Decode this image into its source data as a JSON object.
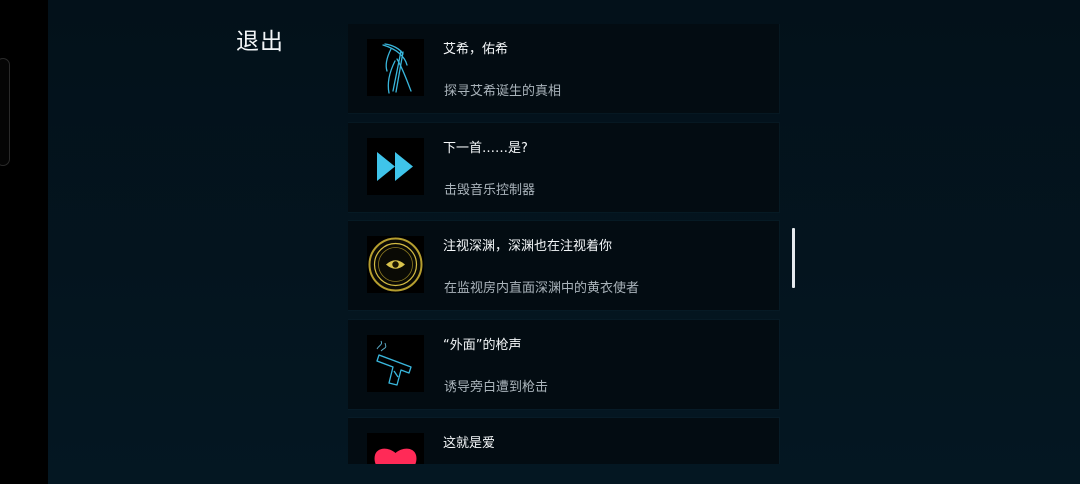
{
  "header": {
    "exit_label": "退出"
  },
  "achievements": [
    {
      "title": "艾希，佑希",
      "description": "探寻艾希诞生的真相",
      "icon": "scythe-icon"
    },
    {
      "title": "下一首……是?",
      "description": "击毁音乐控制器",
      "icon": "fast-forward-icon"
    },
    {
      "title": "注视深渊，深渊也在注视着你",
      "description": "在监视房内直面深渊中的黄衣使者",
      "icon": "eye-emblem-icon"
    },
    {
      "title": "“外面”的枪声",
      "description": "诱导旁白遭到枪击",
      "icon": "pistol-icon"
    },
    {
      "title": "这就是爱",
      "description": "",
      "icon": "heart-icon"
    }
  ],
  "colors": {
    "background": "#04131d",
    "card": "#030c12",
    "accent_cyan": "#3fc4ea",
    "accent_gold": "#c9b23f",
    "heart_pink": "#ff2a57"
  }
}
